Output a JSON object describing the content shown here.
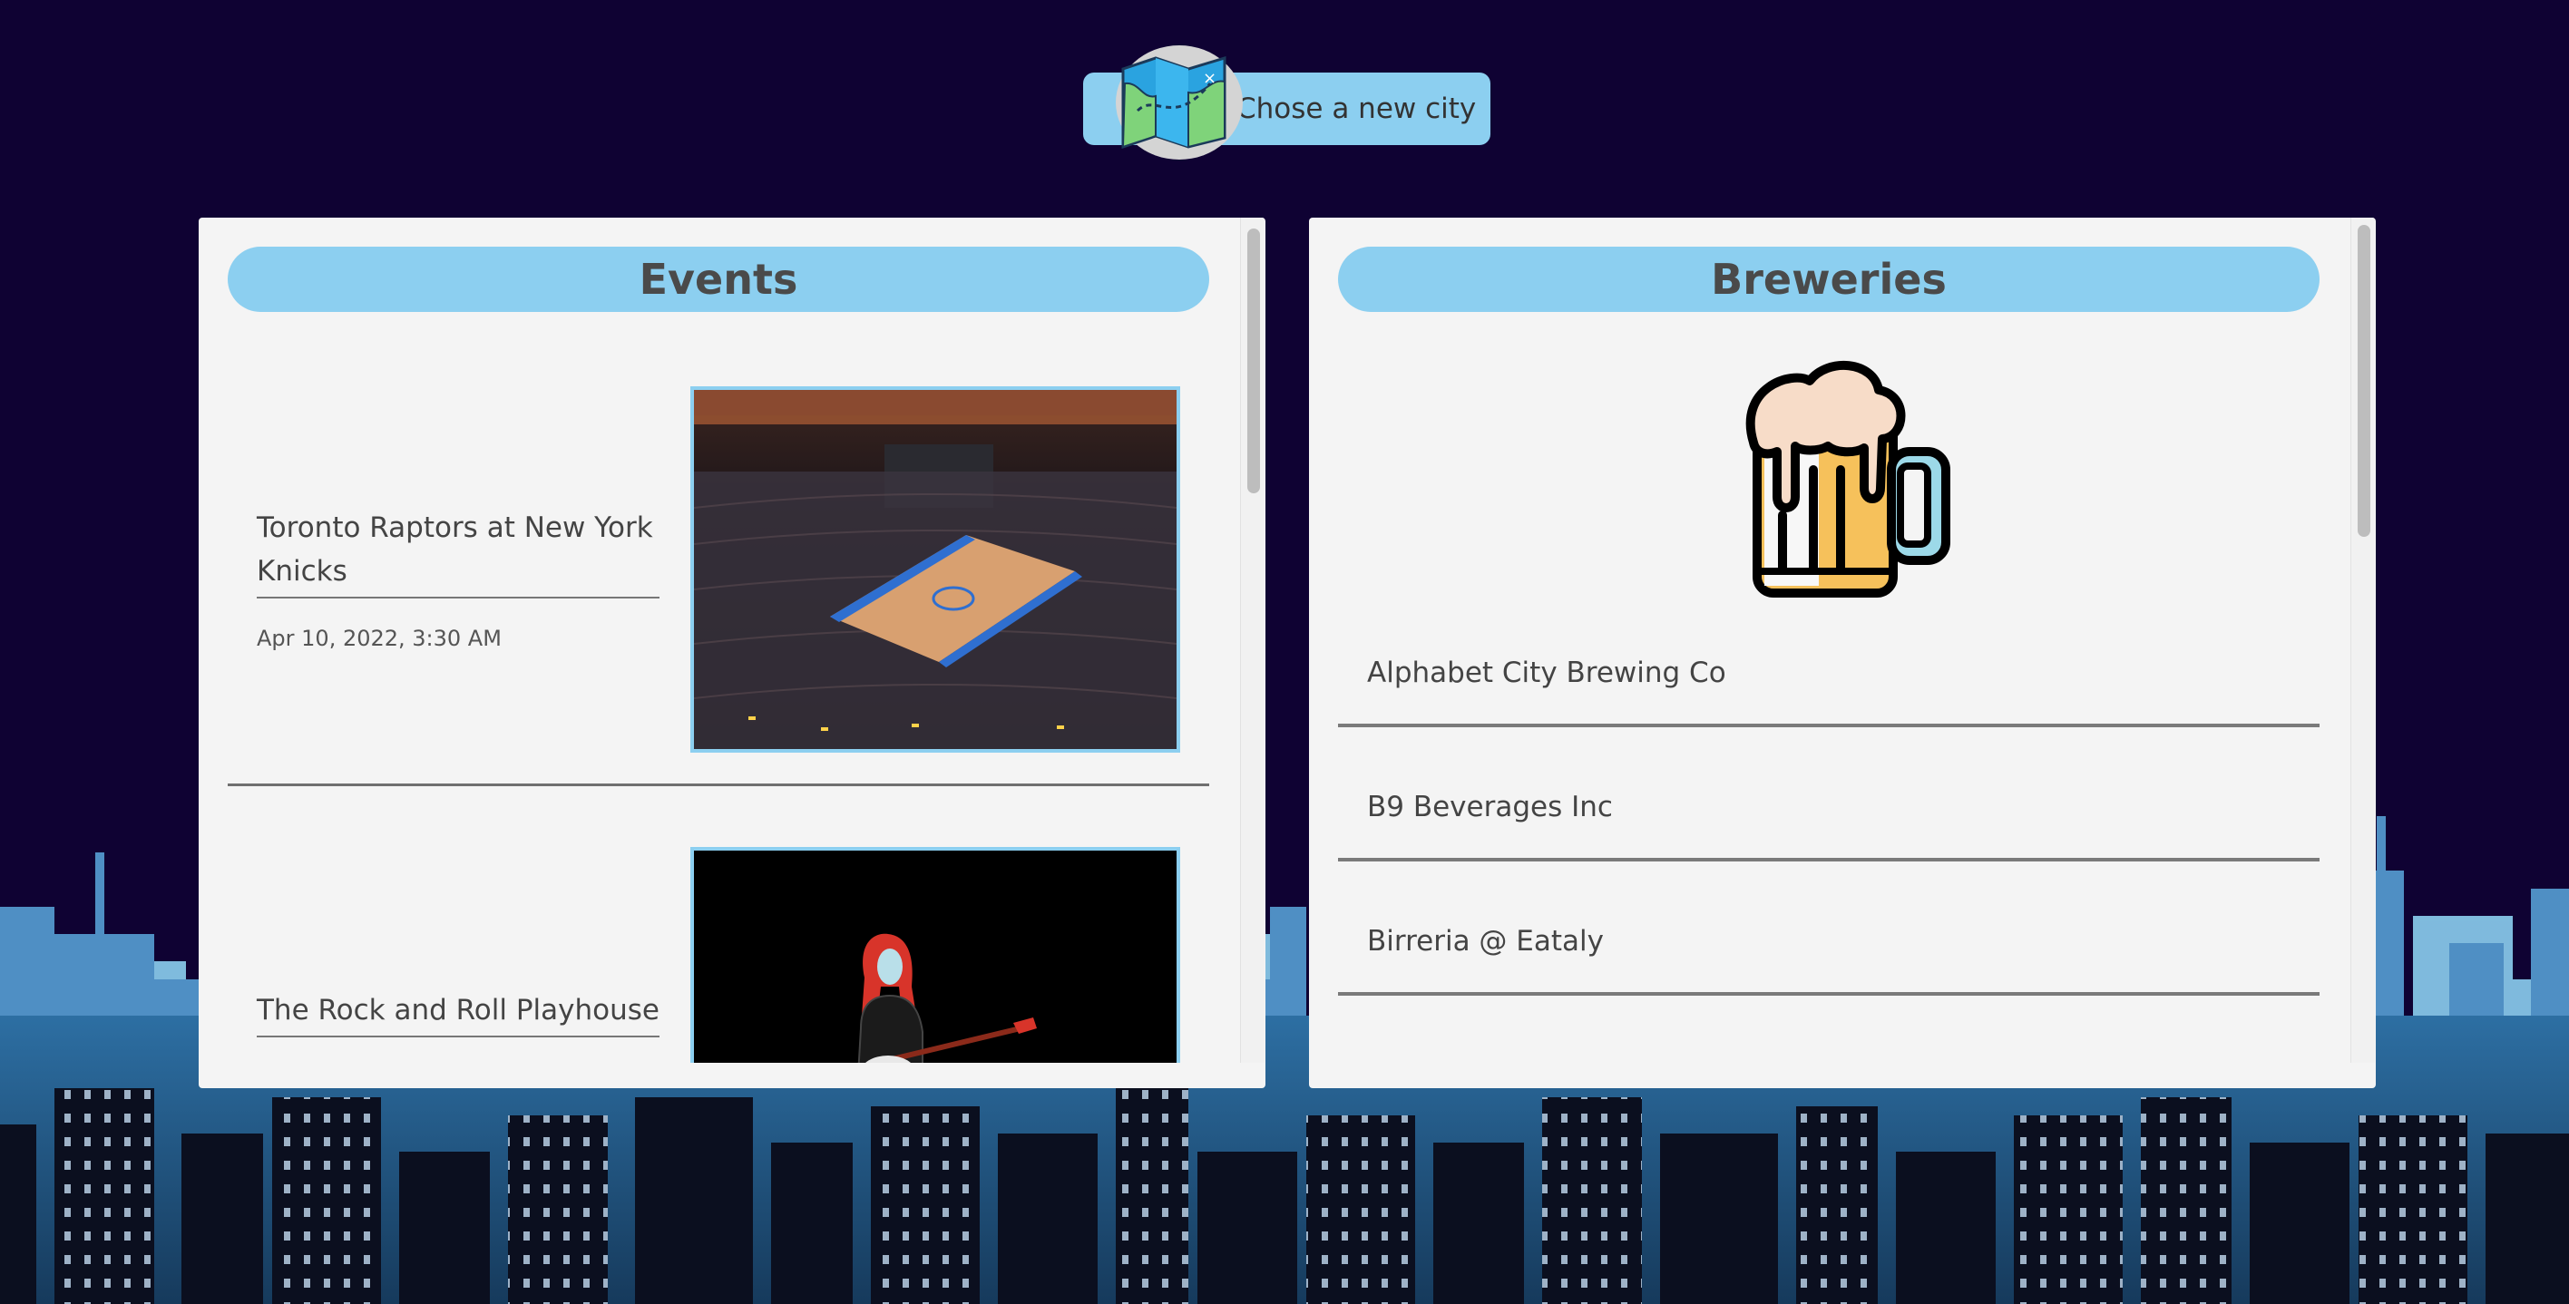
{
  "header": {
    "city_button_label": "Chose a new city"
  },
  "events_panel": {
    "title": "Events",
    "items": [
      {
        "title": "Toronto Raptors at New York Knicks",
        "date": "Apr 10, 2022, 3:30 AM"
      },
      {
        "title": "The Rock and Roll Playhouse",
        "date": ""
      }
    ]
  },
  "breweries_panel": {
    "title": "Breweries",
    "items": [
      {
        "name": "Alphabet City Brewing Co"
      },
      {
        "name": "B9 Beverages Inc"
      },
      {
        "name": "Birreria @ Eataly"
      }
    ]
  },
  "colors": {
    "background": "#0f0233",
    "accent": "#8ccff0",
    "panel": "#f4f4f4"
  },
  "icons": {
    "city_button": "map-icon",
    "breweries": "beer-mug-icon"
  }
}
